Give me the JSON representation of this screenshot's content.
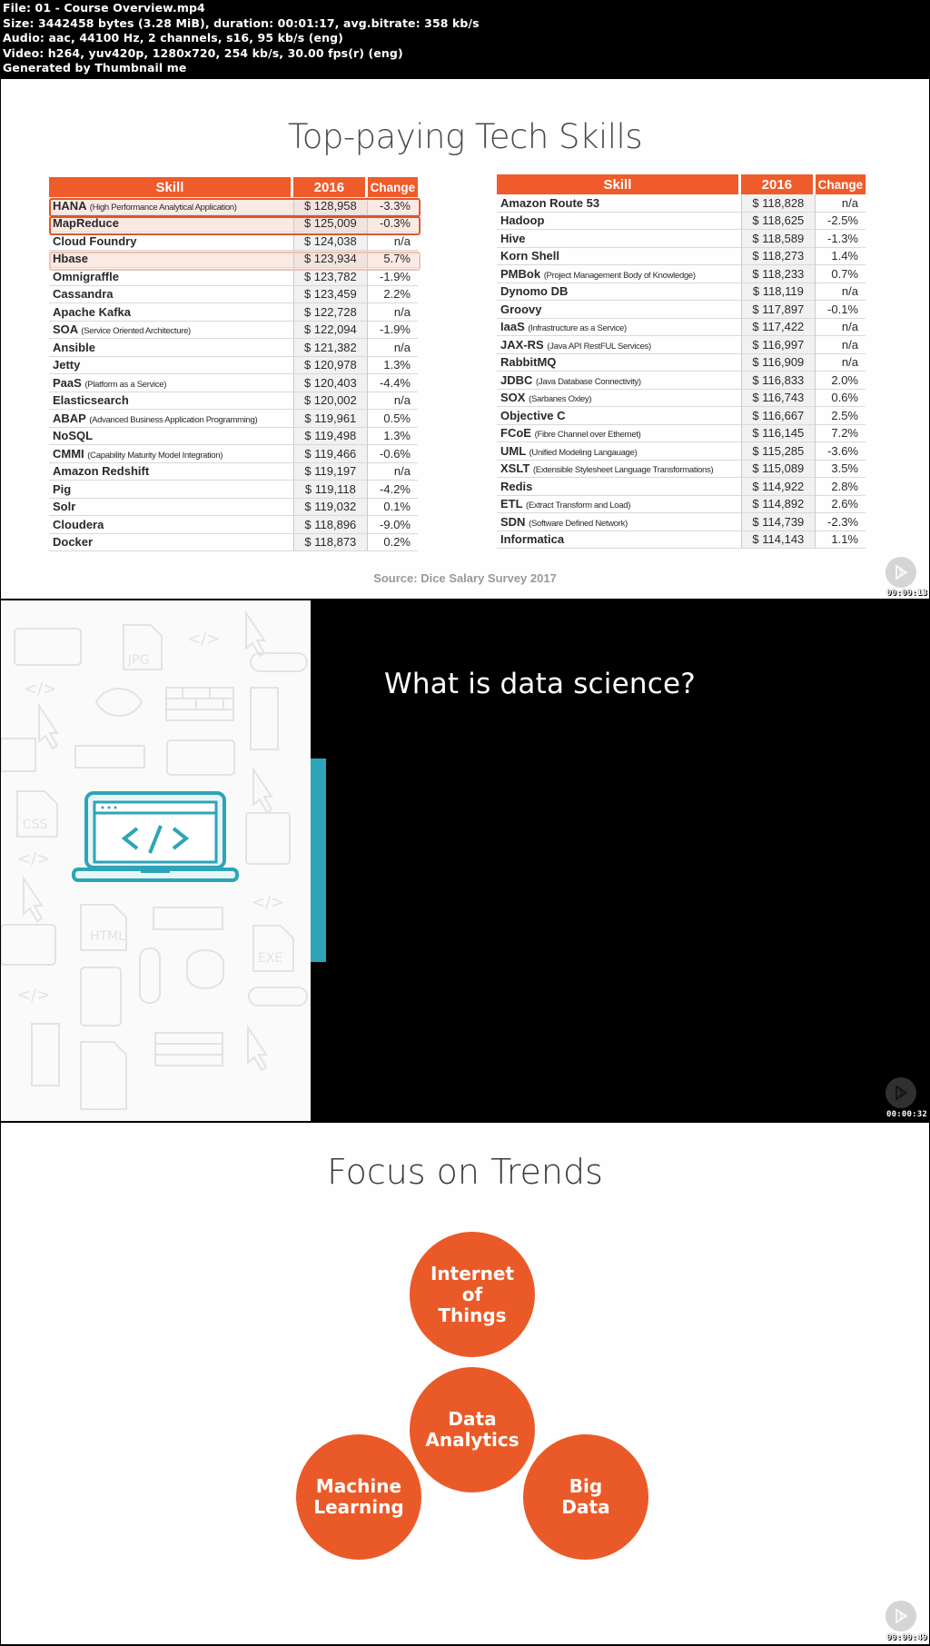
{
  "header": {
    "file": "File: 01 - Course Overview.mp4",
    "size": "Size: 3442458 bytes (3.28 MiB), duration: 00:01:17, avg.bitrate: 358 kb/s",
    "audio": "Audio: aac, 44100 Hz, 2 channels, s16, 95 kb/s (eng)",
    "video": "Video: h264, yuv420p, 1280x720, 254 kb/s, 30.00 fps(r) (eng)",
    "generator": "Generated by Thumbnail me"
  },
  "frames": [
    {
      "title": "Top-paying Tech Skills",
      "columns": [
        "Skill",
        "2016",
        "Change"
      ],
      "left_table": [
        {
          "skill": "HANA",
          "abbr": "(High Performance Analytical Application)",
          "pay": "$ 128,958",
          "change": "-3.3%",
          "highlight": "strong"
        },
        {
          "skill": "MapReduce",
          "abbr": "",
          "pay": "$ 125,009",
          "change": "-0.3%",
          "highlight": "strong"
        },
        {
          "skill": "Cloud Foundry",
          "abbr": "",
          "pay": "$ 124,038",
          "change": "n/a",
          "highlight": ""
        },
        {
          "skill": "Hbase",
          "abbr": "",
          "pay": "$ 123,934",
          "change": "5.7%",
          "highlight": "faint"
        },
        {
          "skill": "Omnigraffle",
          "abbr": "",
          "pay": "$ 123,782",
          "change": "-1.9%",
          "highlight": ""
        },
        {
          "skill": "Cassandra",
          "abbr": "",
          "pay": "$ 123,459",
          "change": "2.2%",
          "highlight": ""
        },
        {
          "skill": "Apache Kafka",
          "abbr": "",
          "pay": "$ 122,728",
          "change": "n/a",
          "highlight": ""
        },
        {
          "skill": "SOA",
          "abbr": "(Service Oriented Architecture)",
          "pay": "$ 122,094",
          "change": "-1.9%",
          "highlight": ""
        },
        {
          "skill": "Ansible",
          "abbr": "",
          "pay": "$ 121,382",
          "change": "n/a",
          "highlight": ""
        },
        {
          "skill": "Jetty",
          "abbr": "",
          "pay": "$ 120,978",
          "change": "1.3%",
          "highlight": ""
        },
        {
          "skill": "PaaS",
          "abbr": "(Platform as a Service)",
          "pay": "$ 120,403",
          "change": "-4.4%",
          "highlight": ""
        },
        {
          "skill": "Elasticsearch",
          "abbr": "",
          "pay": "$ 120,002",
          "change": "n/a",
          "highlight": ""
        },
        {
          "skill": "ABAP",
          "abbr": "(Advanced Business Application Programming)",
          "pay": "$ 119,961",
          "change": "0.5%",
          "highlight": ""
        },
        {
          "skill": "NoSQL",
          "abbr": "",
          "pay": "$ 119,498",
          "change": "1.3%",
          "highlight": ""
        },
        {
          "skill": "CMMI",
          "abbr": "(Capability Maturity Model Integration)",
          "pay": "$ 119,466",
          "change": "-0.6%",
          "highlight": ""
        },
        {
          "skill": "Amazon Redshift",
          "abbr": "",
          "pay": "$ 119,197",
          "change": "n/a",
          "highlight": ""
        },
        {
          "skill": "Pig",
          "abbr": "",
          "pay": "$ 119,118",
          "change": "-4.2%",
          "highlight": ""
        },
        {
          "skill": "Solr",
          "abbr": "",
          "pay": "$ 119,032",
          "change": "0.1%",
          "highlight": ""
        },
        {
          "skill": "Cloudera",
          "abbr": "",
          "pay": "$ 118,896",
          "change": "-9.0%",
          "highlight": ""
        },
        {
          "skill": "Docker",
          "abbr": "",
          "pay": "$ 118,873",
          "change": "0.2%",
          "highlight": ""
        }
      ],
      "right_table": [
        {
          "skill": "Amazon Route 53",
          "abbr": "",
          "pay": "$ 118,828",
          "change": "n/a"
        },
        {
          "skill": "Hadoop",
          "abbr": "",
          "pay": "$ 118,625",
          "change": "-2.5%"
        },
        {
          "skill": "Hive",
          "abbr": "",
          "pay": "$ 118,589",
          "change": "-1.3%"
        },
        {
          "skill": "Korn Shell",
          "abbr": "",
          "pay": "$ 118,273",
          "change": "1.4%"
        },
        {
          "skill": "PMBok",
          "abbr": "(Project Management Body of Knowledge)",
          "pay": "$ 118,233",
          "change": "0.7%"
        },
        {
          "skill": "Dynomo DB",
          "abbr": "",
          "pay": "$ 118,119",
          "change": "n/a"
        },
        {
          "skill": "Groovy",
          "abbr": "",
          "pay": "$ 117,897",
          "change": "-0.1%"
        },
        {
          "skill": "IaaS",
          "abbr": "(Infrastructure as a Service)",
          "pay": "$ 117,422",
          "change": "n/a"
        },
        {
          "skill": "JAX-RS",
          "abbr": "(Java API RestFUL Services)",
          "pay": "$ 116,997",
          "change": "n/a"
        },
        {
          "skill": "RabbitMQ",
          "abbr": "",
          "pay": "$ 116,909",
          "change": "n/a"
        },
        {
          "skill": "JDBC",
          "abbr": "(Java Database Connectivity)",
          "pay": "$ 116,833",
          "change": "2.0%"
        },
        {
          "skill": "SOX",
          "abbr": "(Sarbanes Oxley)",
          "pay": "$ 116,743",
          "change": "0.6%"
        },
        {
          "skill": "Objective C",
          "abbr": "",
          "pay": "$ 116,667",
          "change": "2.5%"
        },
        {
          "skill": "FCoE",
          "abbr": "(Fibre Channel over Ethernet)",
          "pay": "$ 116,145",
          "change": "7.2%"
        },
        {
          "skill": "UML",
          "abbr": "(Unified Modeling Langauage)",
          "pay": "$ 115,285",
          "change": "-3.6%"
        },
        {
          "skill": "XSLT",
          "abbr": "(Extensible Stylesheet Language Transformations)",
          "pay": "$ 115,089",
          "change": "3.5%"
        },
        {
          "skill": "Redis",
          "abbr": "",
          "pay": "$ 114,922",
          "change": "2.8%"
        },
        {
          "skill": "ETL",
          "abbr": "(Extract Transform and Load)",
          "pay": "$ 114,892",
          "change": "2.6%"
        },
        {
          "skill": "SDN",
          "abbr": "(Software Defined Network)",
          "pay": "$ 114,739",
          "change": "-2.3%"
        },
        {
          "skill": "Informatica",
          "abbr": "",
          "pay": "$ 114,143",
          "change": "1.1%"
        }
      ],
      "source": "Source: Dice Salary Survey 2017",
      "timestamp": "00:00:13"
    },
    {
      "question": "What is data science?",
      "icon": "laptop-code-icon",
      "timestamp": "00:00:32"
    },
    {
      "title": "Focus on Trends",
      "bubbles": [
        {
          "label": "Internet of Things",
          "lines": [
            "Internet",
            "of",
            "Things"
          ]
        },
        {
          "label": "Data Analytics",
          "lines": [
            "Data",
            "Analytics"
          ]
        },
        {
          "label": "Machine Learning",
          "lines": [
            "Machine",
            "Learning"
          ]
        },
        {
          "label": "Big Data",
          "lines": [
            "Big",
            "Data"
          ]
        }
      ],
      "timestamp": "00:00:49"
    }
  ],
  "colors": {
    "accent_orange": "#ef5b2a",
    "teal": "#2ea4b8"
  }
}
